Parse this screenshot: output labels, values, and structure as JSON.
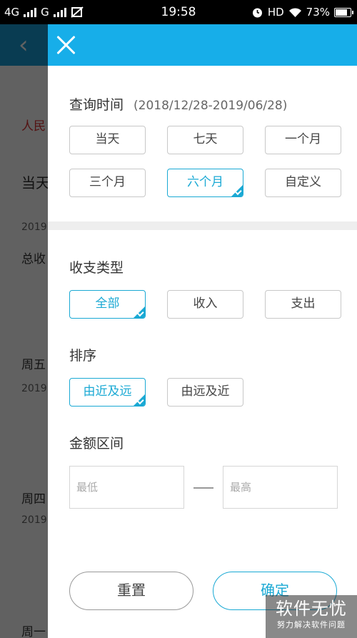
{
  "status_bar": {
    "signal_1": "4G",
    "signal_2": "G",
    "time": "19:58",
    "network": "HD",
    "battery": "73%"
  },
  "background_page": {
    "line_1": "人民",
    "line_2": "当天",
    "line_3": "2019",
    "line_4": "总收",
    "item_1_day": "周五",
    "item_1_date": "2019",
    "item_2_day": "周四",
    "item_2_date": "2019",
    "item_3_day": "周一"
  },
  "filter": {
    "query_time": {
      "title": "查询时间",
      "range": "(2018/12/28-2019/06/28)",
      "options": [
        "当天",
        "七天",
        "一个月",
        "三个月",
        "六个月",
        "自定义"
      ],
      "selected": "六个月"
    },
    "type": {
      "title": "收支类型",
      "options": [
        "全部",
        "收入",
        "支出"
      ],
      "selected": "全部"
    },
    "sort": {
      "title": "排序",
      "options": [
        "由近及远",
        "由远及近"
      ],
      "selected": "由近及远"
    },
    "amount": {
      "title": "金额区间",
      "min_placeholder": "最低",
      "max_placeholder": "最高"
    },
    "reset_label": "重置",
    "confirm_label": "确定"
  },
  "watermark": {
    "title": "软件无忧",
    "subtitle": "努力解决软件问题"
  },
  "colors": {
    "accent": "#1aa9d4",
    "header": "#17aee9"
  }
}
